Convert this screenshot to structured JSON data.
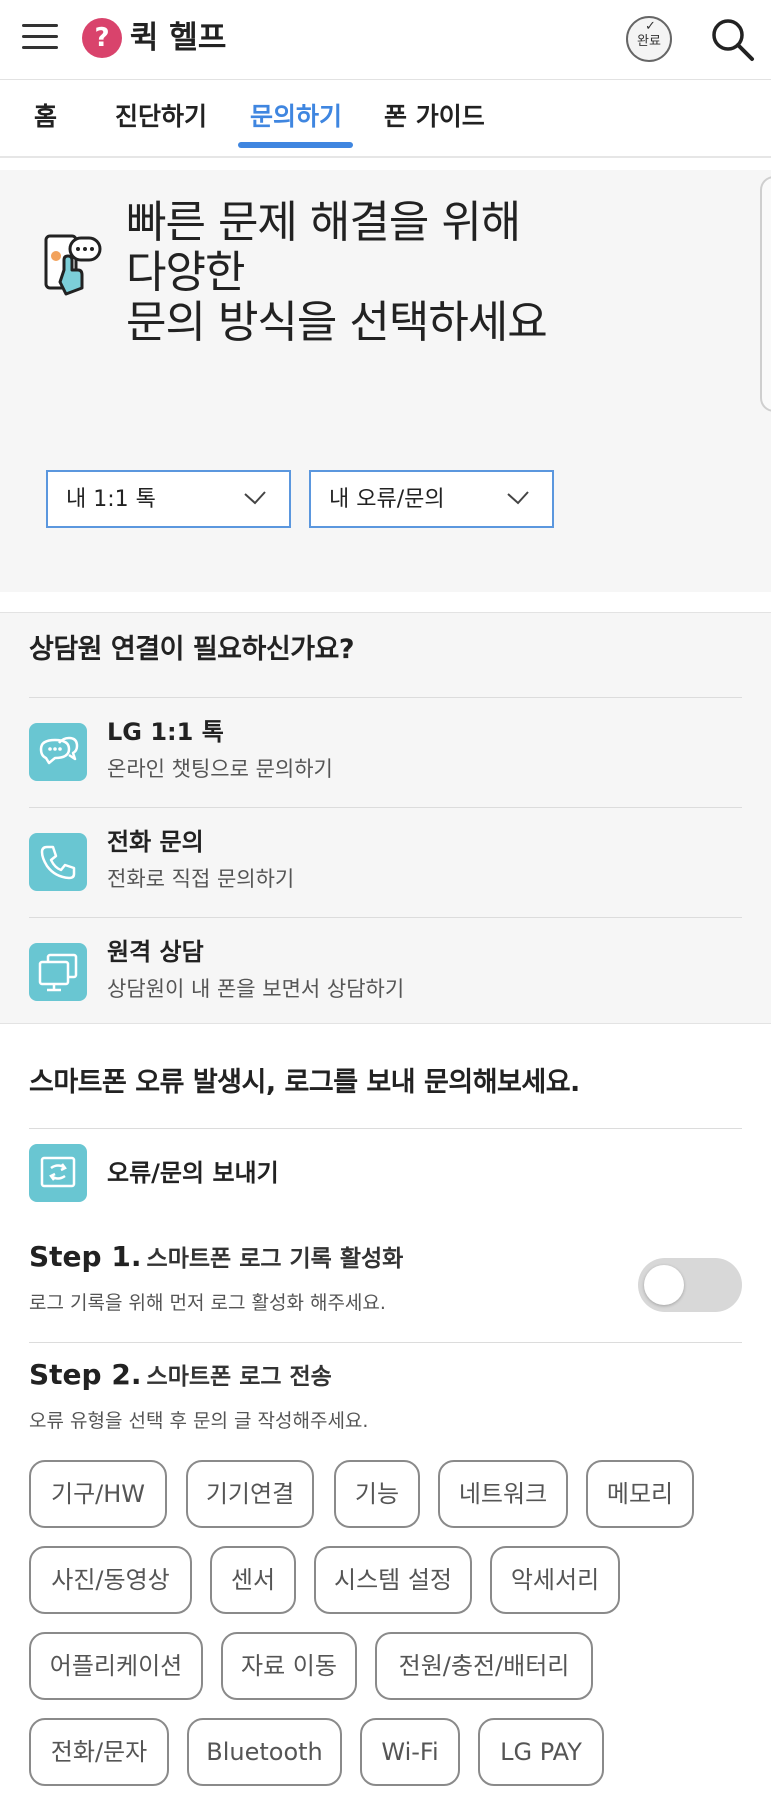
{
  "header": {
    "logo_glyph": "?",
    "title": "퀵 헬프",
    "done_label": "완료",
    "brand_color": "#d9436c"
  },
  "tabs": [
    {
      "label": "홈"
    },
    {
      "label": "진단하기"
    },
    {
      "label": "문의하기",
      "active": true
    },
    {
      "label": "폰 가이드"
    }
  ],
  "accent_color": "#3f86e0",
  "hero": {
    "lines": [
      "빠른 문제 해결을 위해",
      "다양한",
      "문의 방식을 선택하세요"
    ],
    "selectors": [
      {
        "label": "내 1:1 톡"
      },
      {
        "label": "내 오류/문의"
      }
    ]
  },
  "counsel": {
    "title": "상담원 연결이 필요하신가요?",
    "items": [
      {
        "title": "LG 1:1 톡",
        "subtitle": "온라인 챗팅으로 문의하기",
        "icon": "chat-bubbles-icon"
      },
      {
        "title": "전화 문의",
        "subtitle": "전화로 직접 문의하기",
        "icon": "phone-icon"
      },
      {
        "title": "원격 상담",
        "subtitle": "상담원이 내 폰을 보면서 상담하기",
        "icon": "remote-screen-icon"
      }
    ]
  },
  "log": {
    "title": "스마트폰 오류 발생시, 로그를 보내 문의해보세요.",
    "send_label": "오류/문의 보내기",
    "step1": {
      "num": "Step 1.",
      "text": "스마트폰 로그 기록 활성화",
      "desc": "로그 기록을 위해 먼저 로그 활성화 해주세요.",
      "toggle_on": false
    },
    "step2": {
      "num": "Step 2.",
      "text": "스마트폰 로그 전송",
      "desc": "오류 유형을 선택 후 문의 글 작성해주세요."
    },
    "chips": [
      "기구/HW",
      "기기연결",
      "기능",
      "네트워크",
      "메모리",
      "사진/동영상",
      "센서",
      "시스템 설정",
      "악세서리",
      "어플리케이션",
      "자료 이동",
      "전원/충전/배터리",
      "전화/문자",
      "Bluetooth",
      "Wi-Fi",
      "LG PAY"
    ]
  },
  "icon_color": "#69c6d2"
}
